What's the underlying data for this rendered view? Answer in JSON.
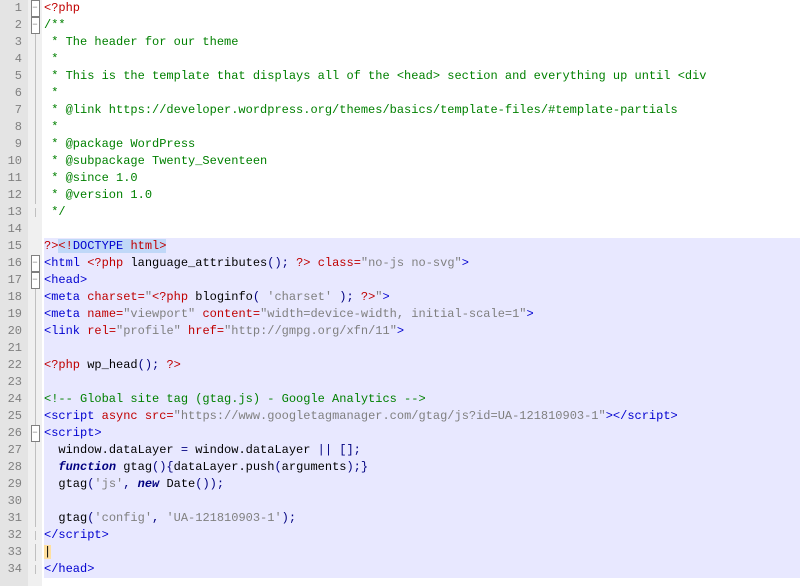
{
  "lines": [
    {
      "n": 1,
      "fold": "box",
      "html": "<span class='php-tag'>&lt;?php</span>"
    },
    {
      "n": 2,
      "fold": "box",
      "html": "<span class='comment'>/**</span>"
    },
    {
      "n": 3,
      "fold": "line",
      "html": "<span class='comment'> * The header for our theme</span>"
    },
    {
      "n": 4,
      "fold": "line",
      "html": "<span class='comment'> *</span>"
    },
    {
      "n": 5,
      "fold": "line",
      "html": "<span class='comment'> * This is the template that displays all of the &lt;head&gt; section and everything up until &lt;div</span>"
    },
    {
      "n": 6,
      "fold": "line",
      "html": "<span class='comment'> *</span>"
    },
    {
      "n": 7,
      "fold": "line",
      "html": "<span class='comment'> * @link https://developer.wordpress.org/themes/basics/template-files/#template-partials</span>"
    },
    {
      "n": 8,
      "fold": "line",
      "html": "<span class='comment'> *</span>"
    },
    {
      "n": 9,
      "fold": "line",
      "html": "<span class='comment'> * @package WordPress</span>"
    },
    {
      "n": 10,
      "fold": "line",
      "html": "<span class='comment'> * @subpackage Twenty_Seventeen</span>"
    },
    {
      "n": 11,
      "fold": "line",
      "html": "<span class='comment'> * @since 1.0</span>"
    },
    {
      "n": 12,
      "fold": "line",
      "html": "<span class='comment'> * @version 1.0</span>"
    },
    {
      "n": 13,
      "fold": "end",
      "html": "<span class='comment'> */</span>"
    },
    {
      "n": 14,
      "fold": "",
      "html": ""
    },
    {
      "n": 15,
      "fold": "",
      "hl": true,
      "html": "<span class='php-tag'>?&gt;</span><span class='sel'><span class='entity'>&lt;!</span><span class='tag'>DOCTYPE</span> <span class='attr'>html</span><span class='entity'>&gt;</span></span>"
    },
    {
      "n": 16,
      "fold": "box",
      "hl": true,
      "html": "<span class='tag'>&lt;html</span> <span class='php-tag'>&lt;?php</span> <span class='ident'>language_attributes</span><span class='op'>();</span> <span class='php-tag'>?&gt;</span> <span class='attr'>class=</span><span class='string'>\"no-js no-svg\"</span><span class='tag'>&gt;</span>"
    },
    {
      "n": 17,
      "fold": "box",
      "hl": true,
      "html": "<span class='tag'>&lt;head&gt;</span>"
    },
    {
      "n": 18,
      "fold": "line",
      "hl": true,
      "html": "<span class='tag'>&lt;meta</span> <span class='attr'>charset=</span><span class='string'>\"</span><span class='php-tag'>&lt;?php</span> <span class='ident'>bloginfo</span><span class='op'>(</span> <span class='string'>'charset'</span> <span class='op'>);</span> <span class='php-tag'>?&gt;</span><span class='string'>\"</span><span class='tag'>&gt;</span>"
    },
    {
      "n": 19,
      "fold": "line",
      "hl": true,
      "html": "<span class='tag'>&lt;meta</span> <span class='attr'>name=</span><span class='string'>\"viewport\"</span> <span class='attr'>content=</span><span class='string'>\"width=device-width, initial-scale=1\"</span><span class='tag'>&gt;</span>"
    },
    {
      "n": 20,
      "fold": "line",
      "hl": true,
      "html": "<span class='tag'>&lt;link</span> <span class='attr'>rel=</span><span class='string'>\"profile\"</span> <span class='attr'>href=</span><span class='string'>\"http://gmpg.org/xfn/11\"</span><span class='tag'>&gt;</span>"
    },
    {
      "n": 21,
      "fold": "line",
      "hl": true,
      "html": ""
    },
    {
      "n": 22,
      "fold": "line",
      "hl": true,
      "html": "<span class='php-tag'>&lt;?php</span> <span class='ident'>wp_head</span><span class='op'>();</span> <span class='php-tag'>?&gt;</span>"
    },
    {
      "n": 23,
      "fold": "line",
      "hl": true,
      "html": ""
    },
    {
      "n": 24,
      "fold": "line",
      "hl": true,
      "html": "<span class='comment'>&lt;!-- Global site tag (gtag.js) - Google Analytics --&gt;</span>"
    },
    {
      "n": 25,
      "fold": "line",
      "hl": true,
      "html": "<span class='tag'>&lt;script</span> <span class='attr'>async src=</span><span class='string'>\"https://www.googletagmanager.com/gtag/js?id=UA-121810903-1\"</span><span class='tag'>&gt;&lt;/script&gt;</span>"
    },
    {
      "n": 26,
      "fold": "box",
      "hl": true,
      "html": "<span class='tag'>&lt;script&gt;</span>"
    },
    {
      "n": 27,
      "fold": "line",
      "hl": true,
      "html": "  <span class='ident'>window.dataLayer</span> <span class='op'>=</span> <span class='ident'>window.dataLayer</span> <span class='op'>||</span> <span class='op'>[];</span>"
    },
    {
      "n": 28,
      "fold": "line",
      "hl": true,
      "html": "  <span class='kw'>function</span> <span class='ident'>gtag</span><span class='op'>(){</span><span class='ident'>dataLayer.push</span><span class='op'>(</span><span class='ident'>arguments</span><span class='op'>);}</span>"
    },
    {
      "n": 29,
      "fold": "line",
      "hl": true,
      "html": "  <span class='ident'>gtag</span><span class='op'>(</span><span class='string'>'js'</span><span class='op'>,</span> <span class='kw'>new</span> <span class='ident'>Date</span><span class='op'>());</span>"
    },
    {
      "n": 30,
      "fold": "line",
      "hl": true,
      "html": ""
    },
    {
      "n": 31,
      "fold": "line",
      "hl": true,
      "html": "  <span class='ident'>gtag</span><span class='op'>(</span><span class='string'>'config'</span><span class='op'>,</span> <span class='string'>'UA-121810903-1'</span><span class='op'>);</span>"
    },
    {
      "n": 32,
      "fold": "end",
      "hl": true,
      "html": "<span class='tag'>&lt;/script&gt;</span>"
    },
    {
      "n": 33,
      "fold": "line",
      "hl": true,
      "html": "<span class='sel2'>|</span>"
    },
    {
      "n": 34,
      "fold": "end",
      "hl": true,
      "html": "<span class='tag'>&lt;/head&gt;</span>"
    }
  ]
}
